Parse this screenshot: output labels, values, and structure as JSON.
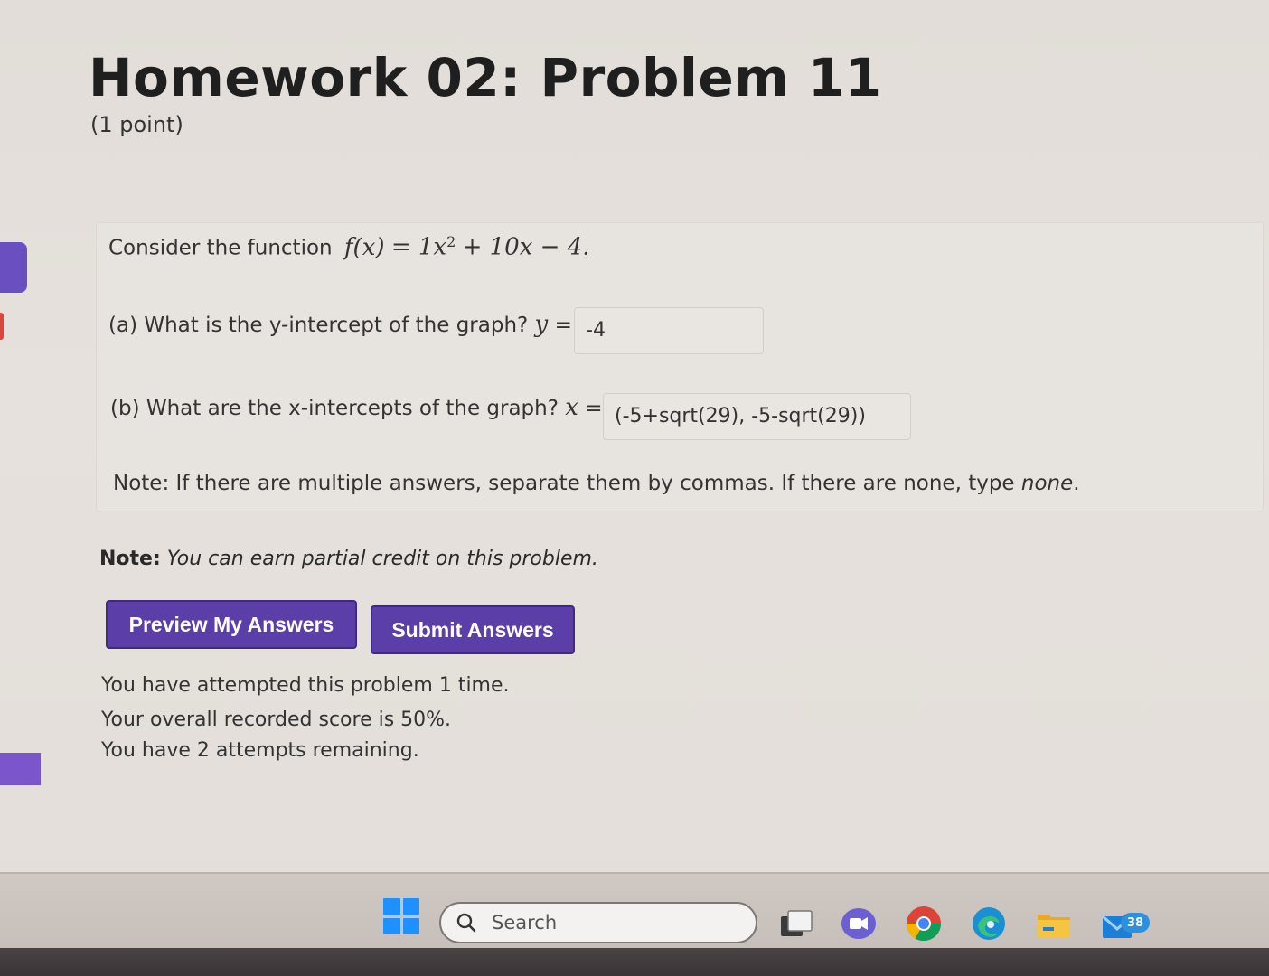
{
  "page": {
    "title": "Homework 02: Problem 11",
    "points": "(1 point)"
  },
  "problem": {
    "intro_text": "Consider the function",
    "function_lhs": "f(x)",
    "function_rhs_a": "= 1x",
    "function_exp": "2",
    "function_rhs_b": "+ 10x − 4.",
    "part_a": {
      "question": "(a) What is the y-intercept of the graph?",
      "var": "y",
      "eq": "=",
      "answer": "-4"
    },
    "part_b": {
      "question": "(b) What are the x-intercepts of the graph?",
      "var": "x",
      "eq": "=",
      "answer": "(-5+sqrt(29), -5-sqrt(29))"
    },
    "note_prefix": "Note: If there are multiple answers, separate them by commas. If there are none, type",
    "note_em": "none",
    "note_suffix": "."
  },
  "credit_note": {
    "label": "Note:",
    "text": "You can earn partial credit on this problem."
  },
  "buttons": {
    "preview": "Preview My Answers",
    "submit": "Submit Answers"
  },
  "status": {
    "attempts": "You have attempted this problem 1 time.",
    "score": "Your overall recorded score is 50%.",
    "remaining": "You have 2 attempts remaining."
  },
  "taskbar": {
    "search_placeholder": "Search",
    "mail_badge": "38",
    "icons": [
      "windows-start-icon",
      "search-icon",
      "task-view-icon",
      "teams-chat-icon",
      "chrome-icon",
      "edge-icon",
      "file-explorer-icon",
      "mail-icon"
    ]
  },
  "colors": {
    "button": "#5b3ea8",
    "accent": "#6a4fc0",
    "page_bg": "#e4dfda"
  }
}
